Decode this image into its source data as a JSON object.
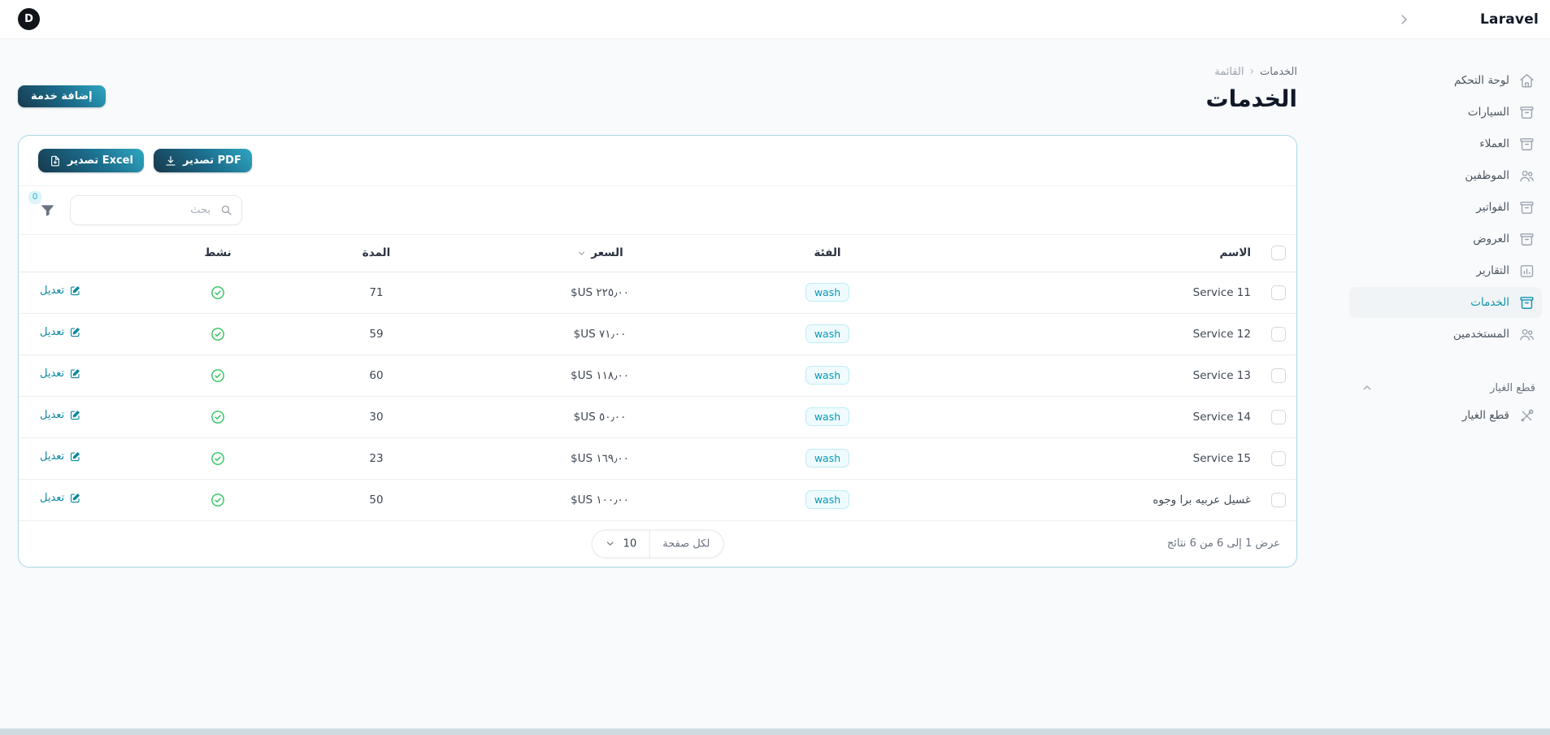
{
  "topbar": {
    "brand": "Laravel",
    "avatar_initial": "D"
  },
  "sidebar": {
    "items": [
      {
        "label": "لوحة التحكم"
      },
      {
        "label": "السيارات"
      },
      {
        "label": "العملاء"
      },
      {
        "label": "الموظفين"
      },
      {
        "label": "الفواتير"
      },
      {
        "label": "العروض"
      },
      {
        "label": "التقارير"
      },
      {
        "label": "الخدمات"
      },
      {
        "label": "المستخدمين"
      }
    ],
    "group_label": "قطع الغيار",
    "group_items": [
      {
        "label": "قطع الغيار"
      }
    ]
  },
  "breadcrumb": {
    "parent": "الخدمات",
    "separator": "‹",
    "current": "القائمة"
  },
  "page_header": {
    "title": "الخدمات",
    "add_service_button": "إضافة خدمة"
  },
  "toolbar": {
    "export_pdf_label": "تصدير PDF",
    "export_excel_label": "تصدير Excel",
    "filter_count": "0",
    "search_placeholder": "بحث"
  },
  "table": {
    "headers": {
      "name": "الاسم",
      "category": "الفئة",
      "price": "السعر",
      "duration": "المدة",
      "active": "نشط"
    },
    "edit_label": "تعديل",
    "rows": [
      {
        "name": "Service 11",
        "category": "wash",
        "price": "$US ٢٢٥٫٠٠",
        "duration": "71"
      },
      {
        "name": "Service 12",
        "category": "wash",
        "price": "$US ٧١٫٠٠",
        "duration": "59"
      },
      {
        "name": "Service 13",
        "category": "wash",
        "price": "$US ١١٨٫٠٠",
        "duration": "60"
      },
      {
        "name": "Service 14",
        "category": "wash",
        "price": "$US ٥٠٫٠٠",
        "duration": "30"
      },
      {
        "name": "Service 15",
        "category": "wash",
        "price": "$US ١٦٩٫٠٠",
        "duration": "23"
      },
      {
        "name": "غسيل عربيه برا وجوه",
        "category": "wash",
        "price": "$US ١٠٠٫٠٠",
        "duration": "50"
      }
    ]
  },
  "pagination": {
    "summary": "عرض 1 إلى 6 من 6 نتائج",
    "per_page_label": "لكل صفحة",
    "per_page_value": "10"
  },
  "colors": {
    "accent_teal": "#0e93ab",
    "button_gradient_light": "#2fa7c1",
    "button_gradient_dark": "#16394c",
    "badge_text": "#0798b5",
    "success_green": "#31c45f"
  }
}
